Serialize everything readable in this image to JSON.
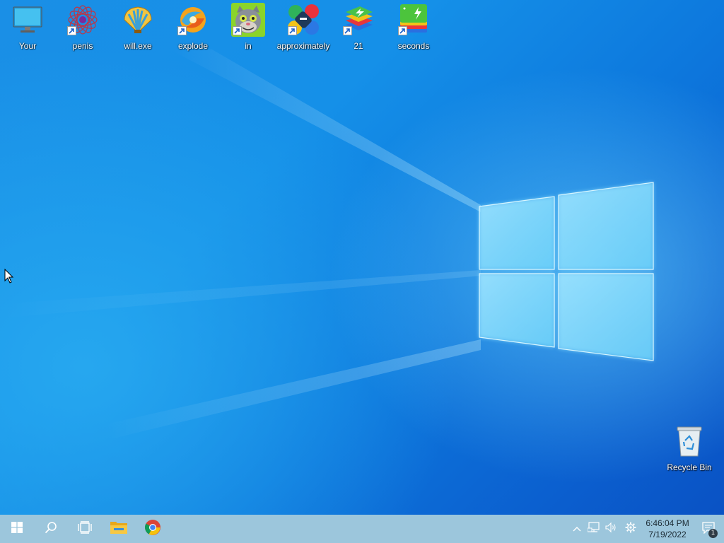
{
  "desktop": {
    "icons": [
      {
        "label": "Your",
        "icon": "this-pc-icon",
        "shortcut": false
      },
      {
        "label": "penis",
        "icon": "red-spiral-icon",
        "shortcut": true
      },
      {
        "label": "will.exe",
        "icon": "shell-icon",
        "shortcut": false
      },
      {
        "label": "explode",
        "icon": "swirl-orb-icon",
        "shortcut": true
      },
      {
        "label": "in",
        "icon": "talking-tom-icon",
        "shortcut": true
      },
      {
        "label": "approximately",
        "icon": "colorful-dots-icon",
        "shortcut": true
      },
      {
        "label": "21",
        "icon": "bluestacks-icon",
        "shortcut": true
      },
      {
        "label": "seconds",
        "icon": "green-stack-icon",
        "shortcut": true
      }
    ],
    "recycle_bin": {
      "label": "Recycle Bin",
      "icon": "recycle-bin-icon"
    }
  },
  "taskbar": {
    "start": "windows-logo-icon",
    "search": "search-icon",
    "task_view": "task-view-icon",
    "pinned": [
      {
        "name": "File Explorer",
        "icon": "folder-icon"
      },
      {
        "name": "Google Chrome",
        "icon": "chrome-icon"
      }
    ],
    "tray": {
      "icons": [
        "chevron-up-icon",
        "network-icon",
        "volume-icon",
        "gear-icon"
      ],
      "time": "6:46:04 PM",
      "date": "7/19/2022",
      "notification_count": "1"
    }
  },
  "colors": {
    "taskbar_bg": "#9cc6dc",
    "desktop_accent": "#1590e8"
  }
}
